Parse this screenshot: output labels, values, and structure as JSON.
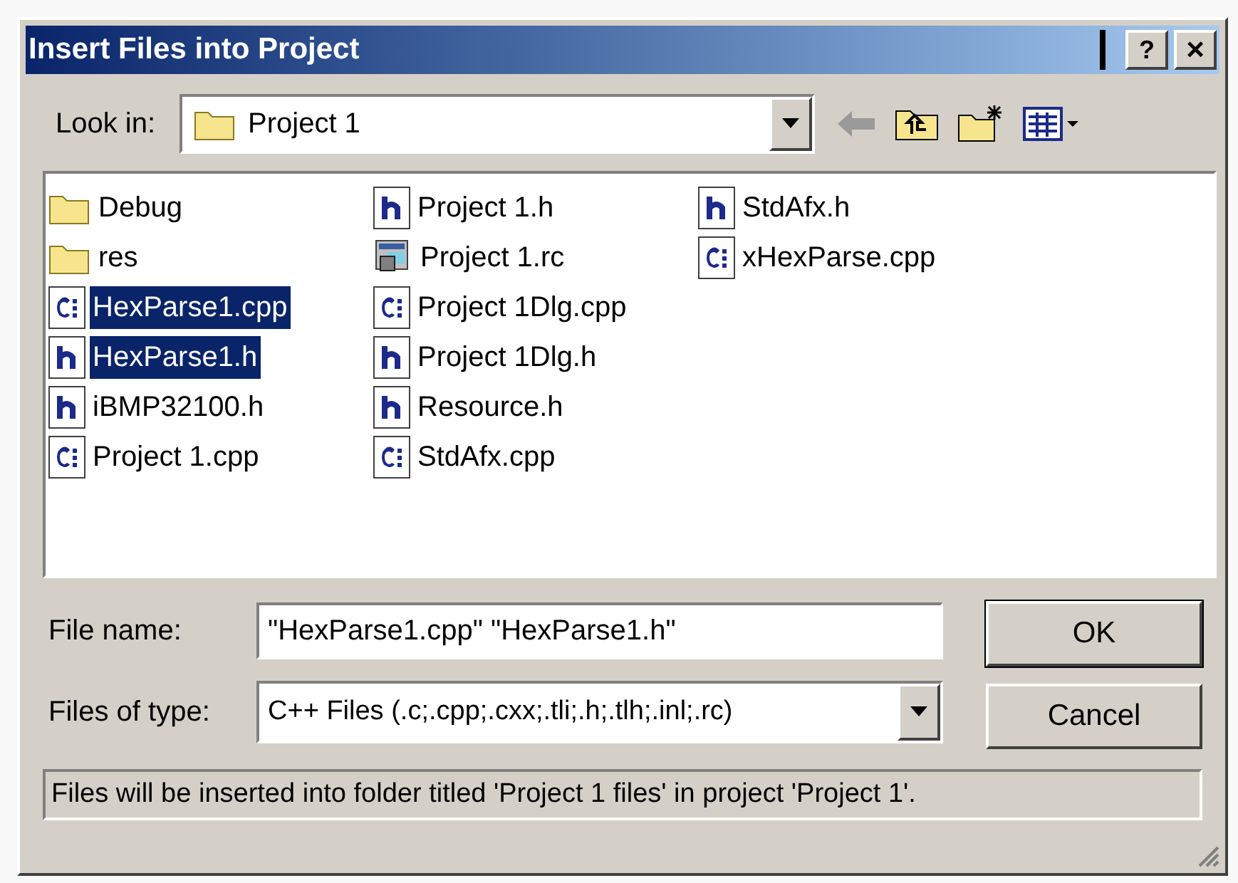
{
  "window": {
    "title": "Insert Files into Project",
    "help_button": "?",
    "close_button": "×"
  },
  "look_in": {
    "label": "Look in:",
    "value": "Project 1"
  },
  "files": [
    {
      "name": "Debug",
      "kind": "folder",
      "selected": false
    },
    {
      "name": "res",
      "kind": "folder",
      "selected": false
    },
    {
      "name": "HexParse1.cpp",
      "kind": "cpp",
      "selected": true
    },
    {
      "name": "HexParse1.h",
      "kind": "h",
      "selected": true
    },
    {
      "name": "iBMP32100.h",
      "kind": "h",
      "selected": false
    },
    {
      "name": "Project 1.cpp",
      "kind": "cpp",
      "selected": false
    },
    {
      "name": "Project 1.h",
      "kind": "h",
      "selected": false
    },
    {
      "name": "Project 1.rc",
      "kind": "rc",
      "selected": false
    },
    {
      "name": "Project 1Dlg.cpp",
      "kind": "cpp",
      "selected": false
    },
    {
      "name": "Project 1Dlg.h",
      "kind": "h",
      "selected": false
    },
    {
      "name": "Resource.h",
      "kind": "h",
      "selected": false
    },
    {
      "name": "StdAfx.cpp",
      "kind": "cpp",
      "selected": false
    },
    {
      "name": "StdAfx.h",
      "kind": "h",
      "selected": false
    },
    {
      "name": "xHexParse.cpp",
      "kind": "cpp",
      "selected": false
    }
  ],
  "file_name": {
    "label": "File name:",
    "value": "\"HexParse1.cpp\" \"HexParse1.h\""
  },
  "files_of_type": {
    "label": "Files of type:",
    "value": "C++ Files (.c;.cpp;.cxx;.tli;.h;.tlh;.inl;.rc)"
  },
  "buttons": [
    "OK",
    "Cancel"
  ],
  "status": "Files will be inserted into folder titled 'Project 1 files' in project 'Project 1'."
}
